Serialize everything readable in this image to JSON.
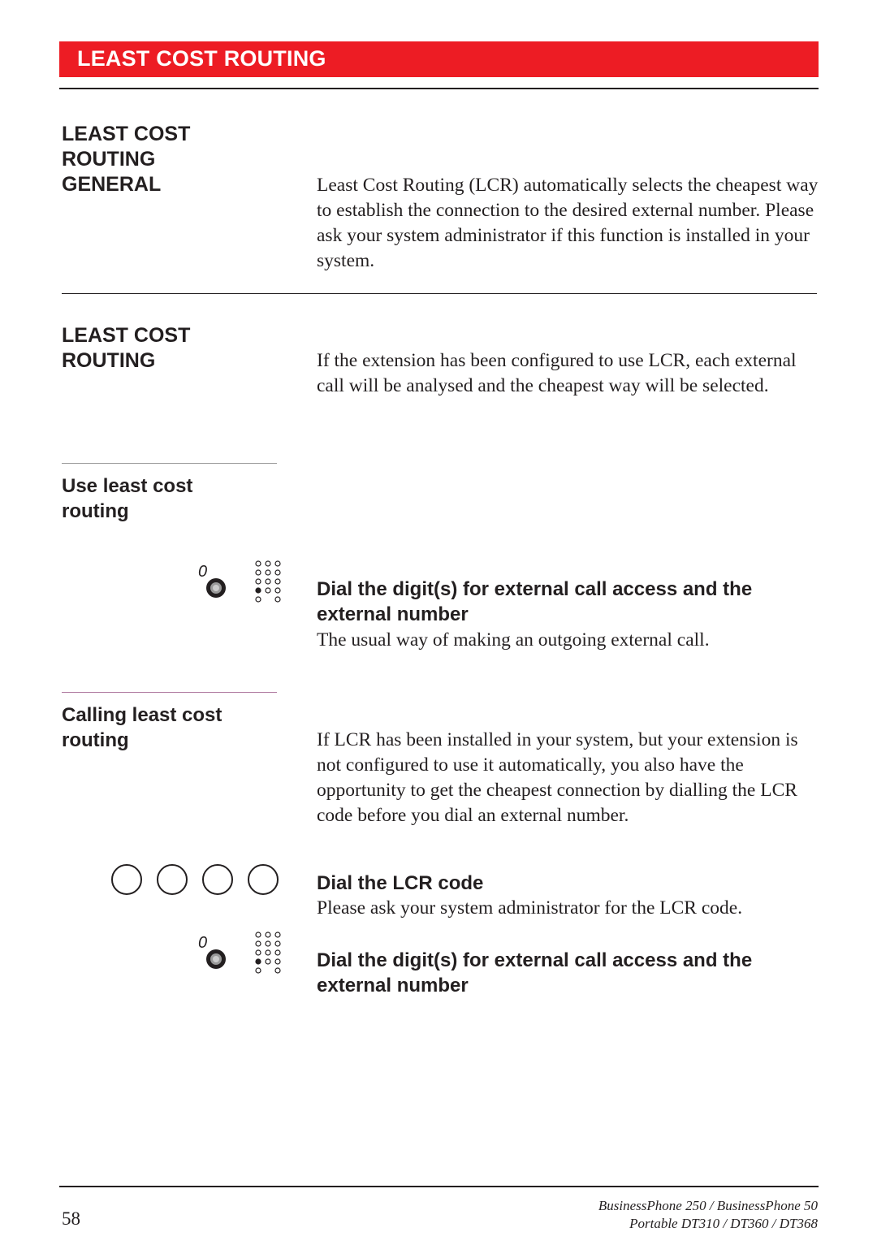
{
  "header": {
    "title": "LEAST COST ROUTING",
    "accent_color": "#ed1c24"
  },
  "sections": [
    {
      "heading": [
        "LEAST COST",
        "ROUTING",
        "GENERAL"
      ],
      "text": "Least Cost Routing (LCR) automatically selects the cheapest way to establish the connection to the desired external number. Please ask your system administrator if this function is installed in your system."
    },
    {
      "heading": [
        "LEAST COST",
        "ROUTING"
      ],
      "text": "If the extension has been configured to use LCR, each external call will be analysed and the cheapest way will be selected."
    }
  ],
  "use": {
    "heading": [
      "Use least cost",
      "routing"
    ],
    "step_title": "Dial the digit(s) for external call access and the external number",
    "step_text": "The usual way of making an outgoing external call.",
    "key_label": "0"
  },
  "calling": {
    "heading": [
      "Calling least cost",
      "routing"
    ],
    "text": "If LCR has been installed in your system, but your extension is not configured to use it automatically, you also have the opportunity to get the cheapest connection by dialling the LCR code before you dial an external number.",
    "step1_title": "Dial the LCR code",
    "step1_text": "Please ask your system administrator for the LCR code.",
    "step2_title": "Dial the digit(s) for external call access and the external number",
    "key_label": "0"
  },
  "footer": {
    "page_number": "58",
    "product_line1": "BusinessPhone 250 / BusinessPhone 50",
    "product_line2": "Portable DT310 / DT360 / DT368"
  },
  "icons": [
    "key-zero-icon",
    "keypad-icon",
    "lcr-code-digit-icon"
  ]
}
